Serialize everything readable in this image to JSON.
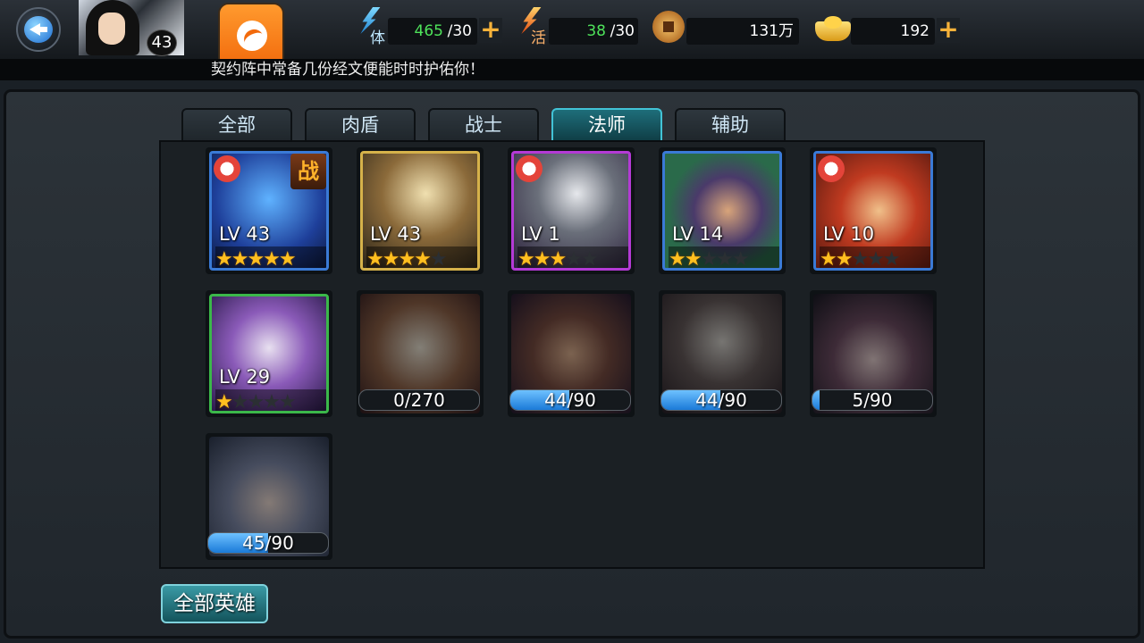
{
  "player": {
    "level": "43"
  },
  "resources": {
    "stamina": {
      "icon": "lightning-icon",
      "label": "体",
      "current": "465",
      "max": "/30"
    },
    "vitality": {
      "icon": "lightning-icon",
      "label": "活",
      "current": "38",
      "max": "/30"
    },
    "coins": {
      "icon": "copper-coin-icon",
      "value": "131万"
    },
    "ingots": {
      "icon": "gold-ingot-icon",
      "value": "192"
    }
  },
  "ticker": "契约阵中常备几份经文便能时时护佑你！",
  "tabs": [
    {
      "label": "全部",
      "active": false
    },
    {
      "label": "肉盾",
      "active": false
    },
    {
      "label": "战士",
      "active": false
    },
    {
      "label": "法师",
      "active": true
    },
    {
      "label": "辅助",
      "active": false
    }
  ],
  "heroes": [
    {
      "level": "LV 43",
      "stars": 5,
      "owned": true,
      "badge": "战",
      "armor": true,
      "border": "#3a7ad6"
    },
    {
      "level": "LV 43",
      "stars": 4,
      "owned": true,
      "armor": false,
      "border": "#d6b24a"
    },
    {
      "level": "LV 1",
      "stars": 3,
      "owned": true,
      "armor": true,
      "border": "#b43ad6"
    },
    {
      "level": "LV 14",
      "stars": 2,
      "owned": true,
      "armor": false,
      "border": "#3a7ad6"
    },
    {
      "level": "LV 10",
      "stars": 2,
      "owned": true,
      "armor": true,
      "border": "#3a7ad6"
    },
    {
      "level": "LV 29",
      "stars": 1,
      "owned": true,
      "armor": false,
      "border": "#3bb84a"
    },
    {
      "owned": false,
      "fragments": "0/270",
      "progress": 0.0
    },
    {
      "owned": false,
      "fragments": "44/90",
      "progress": 0.49
    },
    {
      "owned": false,
      "fragments": "44/90",
      "progress": 0.49
    },
    {
      "owned": false,
      "fragments": "5/90",
      "progress": 0.06
    },
    {
      "owned": false,
      "fragments": "45/90",
      "progress": 0.5
    }
  ],
  "buttons": {
    "all_heroes": "全部英雄"
  },
  "colors": {
    "accent": "#42c3d6",
    "star": "#ffbf1f",
    "green_value": "#4ee25a"
  }
}
